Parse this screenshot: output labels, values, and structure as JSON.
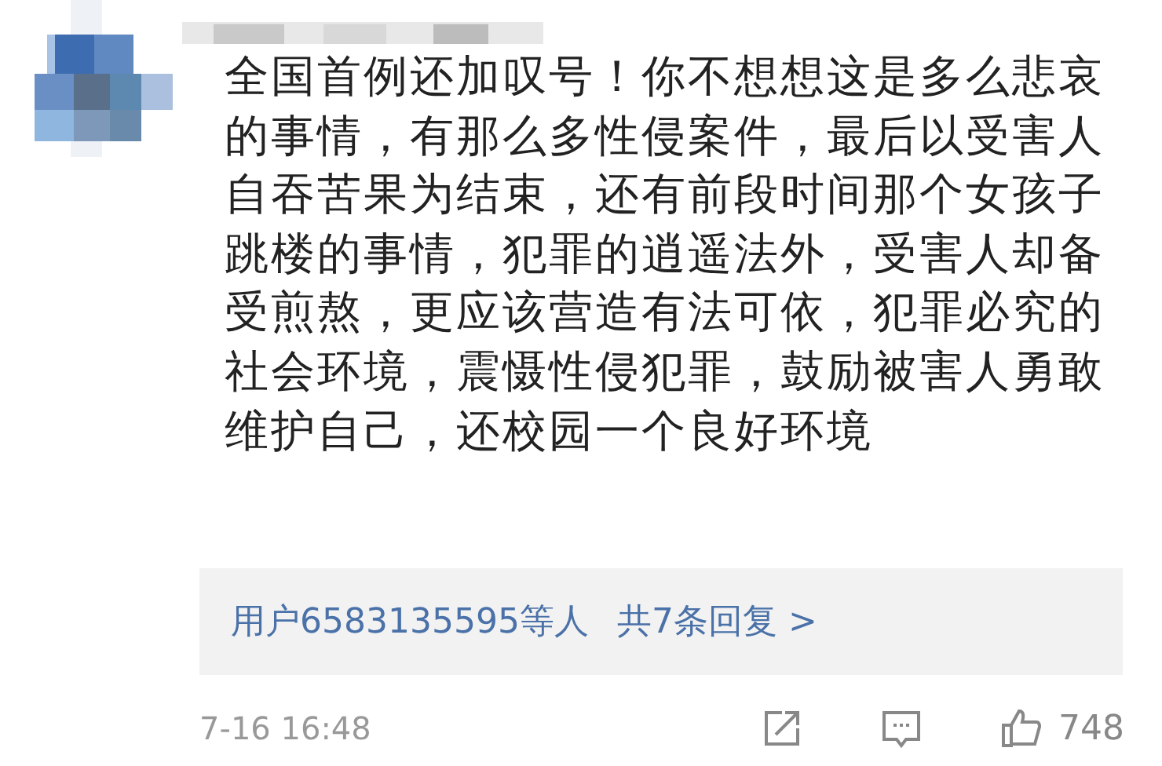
{
  "comment": {
    "text": "全国首例还加叹号！你不想想这是多么悲哀的事情，有那么多性侵案件，最后以受害人自吞苦果为结束，还有前段时间那个女孩子跳楼的事情，犯罪的逍遥法外，受害人却备受煎熬，更应该营造有法可依，犯罪必究的社会环境，震慑性侵犯罪，鼓励被害人勇敢维护自己，还校园一个良好环境",
    "replies": {
      "users": "用户6583135595等人",
      "count": "共7条回复 >"
    },
    "time": "7-16 16:48",
    "likes": "748"
  }
}
